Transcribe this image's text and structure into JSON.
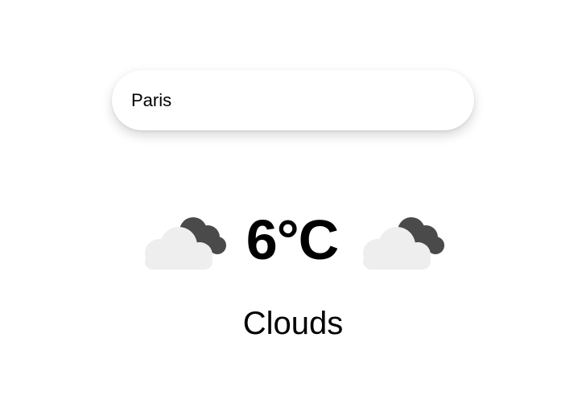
{
  "search": {
    "value": "Paris",
    "placeholder": ""
  },
  "weather": {
    "temperature": "6°C",
    "condition": "Clouds",
    "icon_left": "cloud-icon",
    "icon_right": "cloud-icon"
  },
  "colors": {
    "light_cloud": "#eeeeee",
    "dark_cloud": "#4a4a4a",
    "text": "#000000",
    "background": "#ffffff"
  }
}
